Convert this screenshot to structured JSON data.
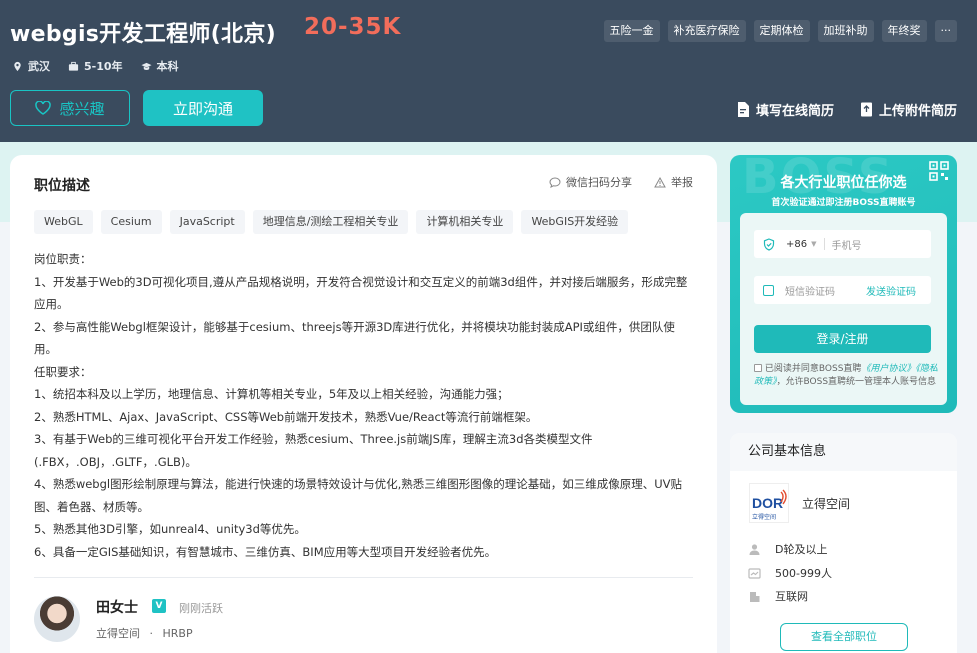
{
  "header": {
    "job_title": "webgis开发工程师(北京)",
    "salary": "20-35K",
    "benefits": [
      "五险一金",
      "补充医疗保险",
      "定期体检",
      "加班补助",
      "年终奖",
      "···"
    ],
    "meta": {
      "location": "武汉",
      "experience": "5-10年",
      "education": "本科"
    },
    "interest_label": "感兴趣",
    "chat_label": "立即沟通",
    "online_resume_label": "填写在线简历",
    "upload_resume_label": "上传附件简历"
  },
  "job": {
    "section_title": "职位描述",
    "share_label": "微信扫码分享",
    "report_label": "举报",
    "tags": [
      "WebGL",
      "Cesium",
      "JavaScript",
      "地理信息/测绘工程相关专业",
      "计算机相关专业",
      "WebGIS开发经验"
    ],
    "description": [
      "岗位职责：",
      "1、开发基于Web的3D可视化项目,遵从产品规格说明，开发符合视觉设计和交互定义的前端3d组件，并对接后端服务，形成完整应用。",
      "2、参与高性能Webgl框架设计，能够基于cesium、threejs等开源3D库进行优化，并将模块功能封装成API或组件，供团队使用。",
      "任职要求：",
      "1、统招本科及以上学历，地理信息、计算机等相关专业，5年及以上相关经验，沟通能力强；",
      "2、熟悉HTML、Ajax、JavaScript、CSS等Web前端开发技术，熟悉Vue/React等流行前端框架。",
      "3、有基于Web的三维可视化平台开发工作经验，熟悉cesium、Three.js前端JS库，理解主流3d各类模型文件(.FBX，.OBJ，.GLTF，.GLB)。",
      "4、熟悉webgl图形绘制原理与算法，能进行快速的场景特效设计与优化,熟悉三维图形图像的理论基础，如三维成像原理、UV贴图、着色器、材质等。",
      "5、熟悉其他3D引擎，如unreal4、unity3d等优先。",
      "6、具备一定GIS基础知识，有智慧城市、三维仿真、BIM应用等大型项目开发经验者优先。"
    ]
  },
  "recruiter": {
    "name": "田女士",
    "verified_badge": "V",
    "status": "刚刚活跃",
    "company": "立得空间",
    "separator": "·",
    "role": "HRBP"
  },
  "login": {
    "watermark": "BOSS",
    "title": "各大行业职位任你选",
    "subtitle": "首次验证通过即注册BOSS直聘账号",
    "country_code": "+86",
    "phone_placeholder": "手机号",
    "code_placeholder": "短信验证码",
    "send_code_label": "发送验证码",
    "submit_label": "登录/注册",
    "agree_prefix": "已阅读并同意BOSS直聘",
    "user_agreement": "《用户协议》",
    "privacy_policy": "《隐私政策》",
    "agree_suffix": "，允许BOSS直聘统一管理本人账号信息"
  },
  "company": {
    "section_title": "公司基本信息",
    "logo_text": "DOR",
    "logo_sub": "立得空间",
    "name": "立得空间",
    "funding": "D轮及以上",
    "size": "500-999人",
    "industry": "互联网",
    "all_jobs_label": "查看全部职位"
  },
  "colors": {
    "header_bg": "#3a4b5e",
    "accent": "#1fc2c4",
    "salary": "#f26d5b"
  }
}
